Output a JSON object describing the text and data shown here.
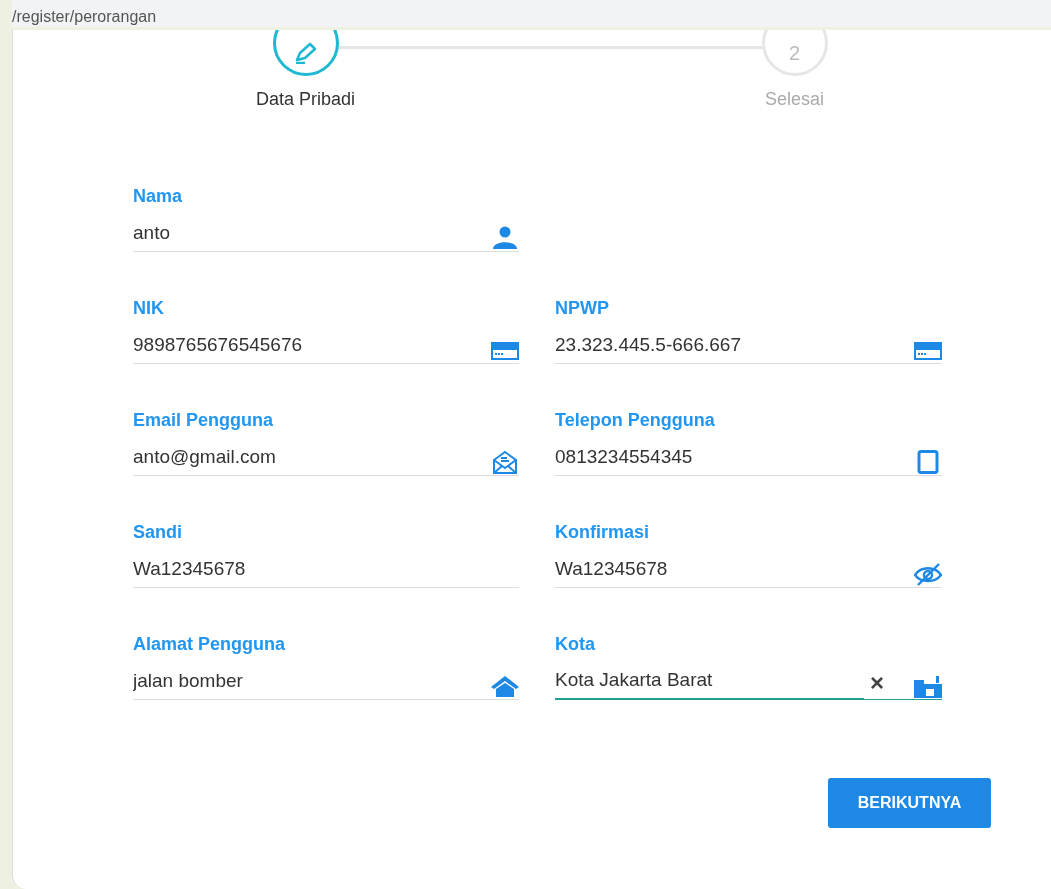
{
  "address_bar": {
    "url": "/register/perorangan"
  },
  "steps": [
    {
      "label": "Data Pribadi",
      "selected": true
    },
    {
      "label": "Selesai",
      "number": "2",
      "selected": false
    }
  ],
  "rows": [
    [
      {
        "kind": "name",
        "label": "Nama",
        "value": "anto",
        "focused": false
      },
      null
    ],
    [
      {
        "kind": "id_number",
        "label": "NIK",
        "value": "9898765676545676",
        "focused": false
      },
      {
        "kind": "id_number",
        "label": "NPWP",
        "value": "23.323.445.5-666.667",
        "focused": false
      }
    ],
    [
      {
        "kind": "email",
        "label": "Email Pengguna",
        "value": "anto@gmail.com",
        "focused": false
      },
      {
        "kind": "phone",
        "label": "Telepon Pengguna",
        "value": "0813234554345",
        "focused": false
      }
    ],
    [
      {
        "kind": "password",
        "label": "Sandi",
        "value": "Wa12345678",
        "focused": false
      },
      {
        "kind": "password_confirm",
        "label": "Konfirmasi",
        "value": "Wa12345678",
        "focused": false
      }
    ],
    [
      {
        "kind": "address",
        "label": "Alamat Pengguna",
        "value": "jalan bomber",
        "focused": false
      },
      {
        "kind": "city",
        "label": "Kota",
        "value": "Kota Jakarta Barat",
        "focused": true,
        "clear": "×"
      }
    ]
  ],
  "next_button": "BERIKUTNYA"
}
